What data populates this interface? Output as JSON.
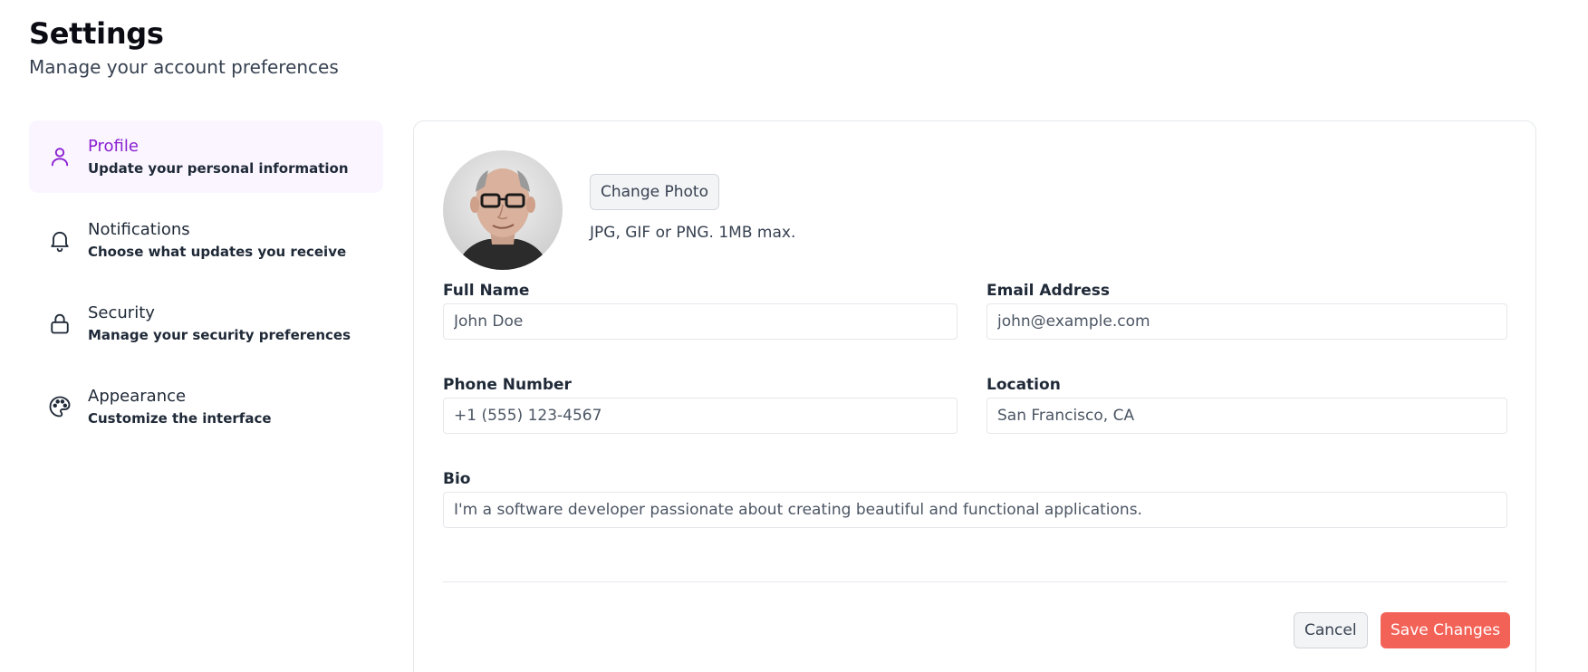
{
  "header": {
    "title": "Settings",
    "subtitle": "Manage your account preferences"
  },
  "sidebar": {
    "items": [
      {
        "label": "Profile",
        "description": "Update your personal information",
        "icon": "user-icon",
        "active": true
      },
      {
        "label": "Notifications",
        "description": "Choose what updates you receive",
        "icon": "bell-icon",
        "active": false
      },
      {
        "label": "Security",
        "description": "Manage your security preferences",
        "icon": "lock-icon",
        "active": false
      },
      {
        "label": "Appearance",
        "description": "Customize the interface",
        "icon": "palette-icon",
        "active": false
      }
    ]
  },
  "profile": {
    "change_photo_label": "Change Photo",
    "photo_hint": "JPG, GIF or PNG. 1MB max.",
    "fields": {
      "full_name": {
        "label": "Full Name",
        "placeholder": "John Doe"
      },
      "email": {
        "label": "Email Address",
        "placeholder": "john@example.com"
      },
      "phone": {
        "label": "Phone Number",
        "placeholder": "+1 (555) 123-4567"
      },
      "location": {
        "label": "Location",
        "placeholder": "San Francisco, CA"
      },
      "bio": {
        "label": "Bio",
        "placeholder": "I'm a software developer passionate about creating beautiful and functional applications."
      }
    },
    "cancel_label": "Cancel",
    "save_label": "Save Changes"
  },
  "colors": {
    "accent": "#8b1fd1",
    "active_bg": "#faf5ff",
    "primary_button": "#f26257"
  }
}
